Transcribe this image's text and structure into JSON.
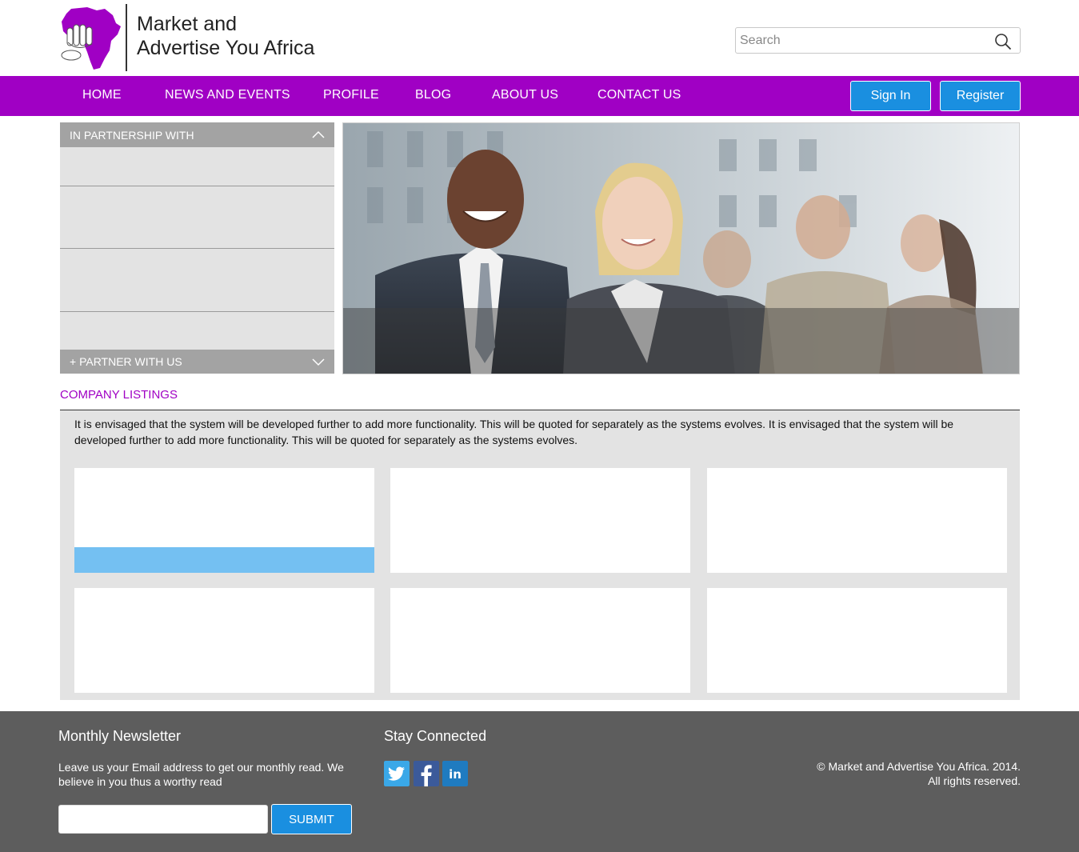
{
  "brand": {
    "name_line1": "Market and",
    "name_line2": "Advertise You Africa",
    "logo_color": "#a000c4"
  },
  "search": {
    "placeholder": "Search",
    "icon": "search-icon"
  },
  "nav": {
    "items": [
      {
        "label": "HOME"
      },
      {
        "label": "NEWS AND EVENTS"
      },
      {
        "label": "PROFILE"
      },
      {
        "label": "BLOG"
      },
      {
        "label": "ABOUT US"
      },
      {
        "label": "CONTACT US"
      }
    ],
    "sign_in": "Sign In",
    "register": "Register",
    "bg_color": "#a000c4",
    "button_color": "#1a8fe0"
  },
  "partners": {
    "header": "IN PARTNERSHIP WITH",
    "footer": "+ PARTNER WITH US",
    "icons": [
      "chevron-up-icon",
      "chevron-down-icon"
    ]
  },
  "listings": {
    "title": "COMPANY LISTINGS",
    "description": "It is envisaged that the system will be developed further to add more functionality.  This will be quoted for separately as the systems evolves. It is envisaged that the system will be developed further to add more functionality.  This will be quoted for separately as the systems evolves.",
    "highlight_color": "#74c0f2"
  },
  "footer": {
    "newsletter_title": "Monthly Newsletter",
    "newsletter_text": "Leave us your Email address to get our monthly read. We believe in you thus a worthy read",
    "submit_label": "SUBMIT",
    "connected_title": "Stay Connected",
    "social_icons": [
      "twitter-icon",
      "facebook-icon",
      "linkedin-icon"
    ],
    "copyright_line1": "© Market and Advertise You Africa. 2014.",
    "copyright_line2": "All rights reserved.",
    "bg_color": "#5d5d5d"
  }
}
